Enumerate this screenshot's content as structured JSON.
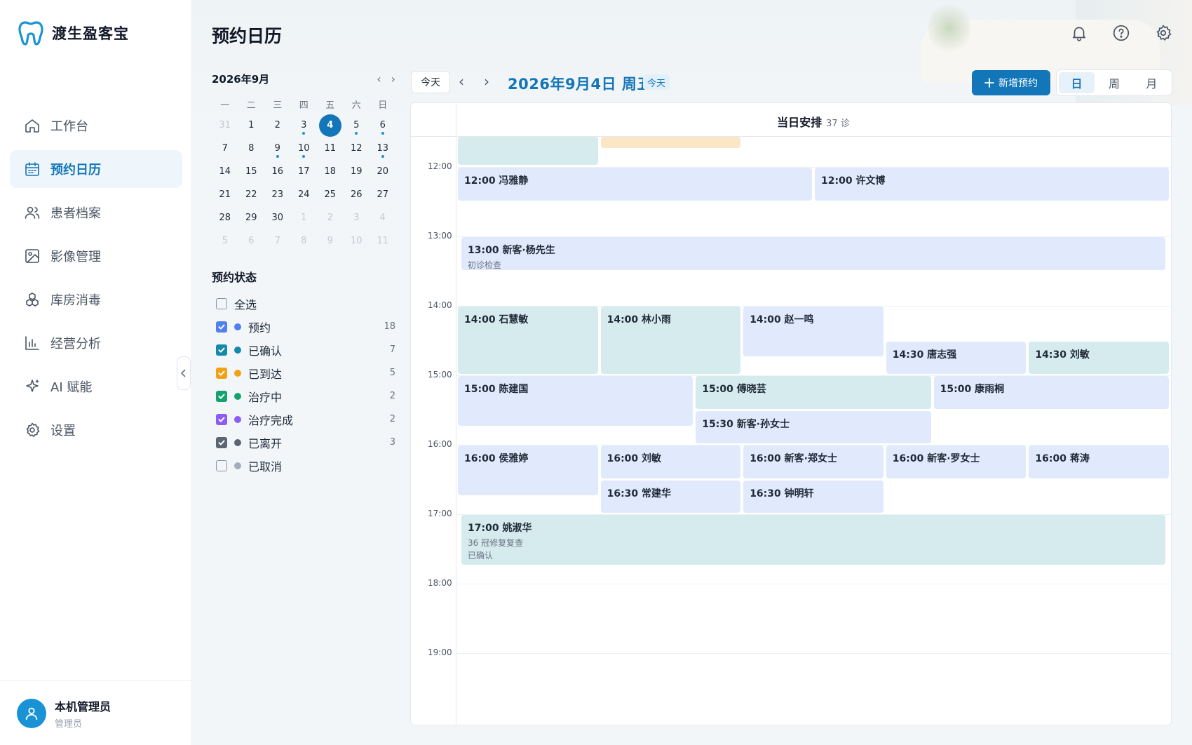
{
  "app": {
    "name": "渡生盈客宝"
  },
  "nav": [
    {
      "label": "工作台",
      "icon": "home-icon",
      "active": false
    },
    {
      "label": "预约日历",
      "icon": "calendar-icon",
      "active": true
    },
    {
      "label": "患者档案",
      "icon": "users-icon",
      "active": false
    },
    {
      "label": "影像管理",
      "icon": "image-icon",
      "active": false
    },
    {
      "label": "库房消毒",
      "icon": "boxes-icon",
      "active": false
    },
    {
      "label": "经营分析",
      "icon": "bar-chart-icon",
      "active": false
    },
    {
      "label": "AI 赋能",
      "icon": "sparkle-icon",
      "active": false
    },
    {
      "label": "设置",
      "icon": "gear-icon",
      "active": false
    }
  ],
  "user": {
    "name": "本机管理员",
    "role": "管理员"
  },
  "page": {
    "title": "预约日历"
  },
  "mini_calendar": {
    "title": "2026年9月",
    "weekdays": [
      "一",
      "二",
      "三",
      "四",
      "五",
      "六",
      "日"
    ],
    "days": [
      {
        "d": "31",
        "other": true
      },
      {
        "d": "1"
      },
      {
        "d": "2"
      },
      {
        "d": "3",
        "dot": true
      },
      {
        "d": "4",
        "selected": true
      },
      {
        "d": "5",
        "dot": true
      },
      {
        "d": "6",
        "dot": true
      },
      {
        "d": "7"
      },
      {
        "d": "8"
      },
      {
        "d": "9",
        "dot": true
      },
      {
        "d": "10",
        "dot": true
      },
      {
        "d": "11"
      },
      {
        "d": "12"
      },
      {
        "d": "13",
        "dot": true
      },
      {
        "d": "14"
      },
      {
        "d": "15"
      },
      {
        "d": "16"
      },
      {
        "d": "17"
      },
      {
        "d": "18"
      },
      {
        "d": "19"
      },
      {
        "d": "20"
      },
      {
        "d": "21"
      },
      {
        "d": "22"
      },
      {
        "d": "23"
      },
      {
        "d": "24"
      },
      {
        "d": "25"
      },
      {
        "d": "26"
      },
      {
        "d": "27"
      },
      {
        "d": "28"
      },
      {
        "d": "29"
      },
      {
        "d": "30"
      },
      {
        "d": "1",
        "other": true
      },
      {
        "d": "2",
        "other": true
      },
      {
        "d": "3",
        "other": true
      },
      {
        "d": "4",
        "other": true
      },
      {
        "d": "5",
        "other": true
      },
      {
        "d": "6",
        "other": true
      },
      {
        "d": "7",
        "other": true
      },
      {
        "d": "8",
        "other": true
      },
      {
        "d": "9",
        "other": true
      },
      {
        "d": "10",
        "other": true
      },
      {
        "d": "11",
        "other": true
      }
    ]
  },
  "status_filter": {
    "title": "预约状态",
    "items": [
      {
        "label": "全选",
        "checked": false,
        "color": null,
        "count": ""
      },
      {
        "label": "预约",
        "checked": true,
        "color": "#4f7ff0",
        "count": "18"
      },
      {
        "label": "已确认",
        "checked": true,
        "color": "#1789a8",
        "count": "7"
      },
      {
        "label": "已到达",
        "checked": true,
        "color": "#f2a114",
        "count": "5"
      },
      {
        "label": "治疗中",
        "checked": true,
        "color": "#14a36f",
        "count": "2"
      },
      {
        "label": "治疗完成",
        "checked": true,
        "color": "#8b5cf6",
        "count": "2"
      },
      {
        "label": "已离开",
        "checked": true,
        "color": "#5b6573",
        "count": "3"
      },
      {
        "label": "已取消",
        "checked": false,
        "color": "#a4adb8",
        "count": ""
      }
    ]
  },
  "toolbar": {
    "today_label": "今天",
    "current_date": "2026年9月4日 周五",
    "today_tag": "今天",
    "new_label": "新增预约",
    "views": [
      {
        "label": "日",
        "active": true
      },
      {
        "label": "周",
        "active": false
      },
      {
        "label": "月",
        "active": false
      }
    ]
  },
  "day_view": {
    "header_title": "当日安排",
    "header_count": "37 诊",
    "hours": [
      "12:00",
      "13:00",
      "14:00",
      "15:00",
      "16:00",
      "17:00",
      "18:00",
      "19:00"
    ],
    "events": [
      {
        "title": "",
        "sub": "",
        "color": "teal",
        "start": 11.55,
        "end": 12.0,
        "col": 0,
        "span": 1,
        "cols": 5
      },
      {
        "title": "",
        "sub": "",
        "color": "tan",
        "start": 11.55,
        "end": 11.75,
        "col": 1,
        "span": 1,
        "cols": 5
      },
      {
        "title": "12:00 冯雅静",
        "sub": "",
        "color": "blue",
        "start": 12.0,
        "end": 12.5,
        "col": 0,
        "span": 1,
        "cols": 2
      },
      {
        "title": "12:00 许文博",
        "sub": "",
        "color": "blue",
        "start": 12.0,
        "end": 12.5,
        "col": 1,
        "span": 1,
        "cols": 2
      },
      {
        "title": "13:00 新客·杨先生",
        "sub": "初诊检查",
        "color": "blue",
        "start": 13.0,
        "end": 13.5,
        "col": 0,
        "span": 1,
        "cols": 1,
        "inset": true
      },
      {
        "title": "14:00 石慧敏",
        "sub": "",
        "color": "teal",
        "start": 14.0,
        "end": 15.0,
        "col": 0,
        "span": 1,
        "cols": 5
      },
      {
        "title": "14:00 林小雨",
        "sub": "",
        "color": "teal",
        "start": 14.0,
        "end": 15.0,
        "col": 1,
        "span": 1,
        "cols": 5
      },
      {
        "title": "14:00 赵一鸣",
        "sub": "",
        "color": "blue",
        "start": 14.0,
        "end": 14.75,
        "col": 2,
        "span": 1,
        "cols": 5
      },
      {
        "title": "14:30 唐志强",
        "sub": "",
        "color": "blue",
        "start": 14.5,
        "end": 15.0,
        "col": 3,
        "span": 1,
        "cols": 5
      },
      {
        "title": "14:30 刘敏",
        "sub": "",
        "color": "teal",
        "start": 14.5,
        "end": 15.0,
        "col": 4,
        "span": 1,
        "cols": 5
      },
      {
        "title": "15:00 陈建国",
        "sub": "",
        "color": "blue",
        "start": 15.0,
        "end": 15.75,
        "col": 0,
        "span": 1,
        "cols": 3
      },
      {
        "title": "15:00 傅晓芸",
        "sub": "",
        "color": "teal",
        "start": 15.0,
        "end": 15.5,
        "col": 1,
        "span": 1,
        "cols": 3
      },
      {
        "title": "15:00 康雨桐",
        "sub": "",
        "color": "blue",
        "start": 15.0,
        "end": 15.5,
        "col": 2,
        "span": 1,
        "cols": 3
      },
      {
        "title": "15:30 新客·孙女士",
        "sub": "",
        "color": "blue",
        "start": 15.5,
        "end": 16.0,
        "col": 1,
        "span": 1,
        "cols": 3
      },
      {
        "title": "16:00 侯雅婷",
        "sub": "",
        "color": "blue",
        "start": 16.0,
        "end": 16.75,
        "col": 0,
        "span": 1,
        "cols": 5
      },
      {
        "title": "16:00 刘敏",
        "sub": "",
        "color": "blue",
        "start": 16.0,
        "end": 16.5,
        "col": 1,
        "span": 1,
        "cols": 5
      },
      {
        "title": "16:00 新客·郑女士",
        "sub": "",
        "color": "blue",
        "start": 16.0,
        "end": 16.5,
        "col": 2,
        "span": 1,
        "cols": 5
      },
      {
        "title": "16:00 新客·罗女士",
        "sub": "",
        "color": "blue",
        "start": 16.0,
        "end": 16.5,
        "col": 3,
        "span": 1,
        "cols": 5
      },
      {
        "title": "16:00 蒋涛",
        "sub": "",
        "color": "blue",
        "start": 16.0,
        "end": 16.5,
        "col": 4,
        "span": 1,
        "cols": 5
      },
      {
        "title": "16:30 常建华",
        "sub": "",
        "color": "blue",
        "start": 16.5,
        "end": 17.0,
        "col": 1,
        "span": 1,
        "cols": 5
      },
      {
        "title": "16:30 钟明轩",
        "sub": "",
        "color": "blue",
        "start": 16.5,
        "end": 17.0,
        "col": 2,
        "span": 1,
        "cols": 5
      },
      {
        "title": "17:00 姚淑华",
        "sub": "36 冠修复复查",
        "sub2": "已确认",
        "color": "teal",
        "start": 17.0,
        "end": 17.75,
        "col": 0,
        "span": 1,
        "cols": 1,
        "inset": true
      }
    ]
  }
}
